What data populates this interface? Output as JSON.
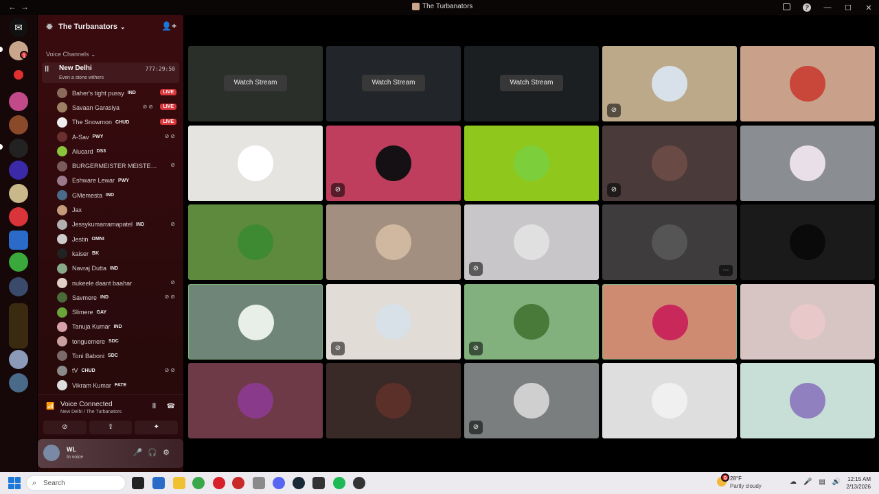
{
  "window": {
    "title": "The Turbanators"
  },
  "server": {
    "name": "The Turbanators"
  },
  "category": "Voice Channels",
  "voice_channel": {
    "name": "New Delhi",
    "timer": "777:29:50",
    "status": "Even a stone withers"
  },
  "members": [
    {
      "name": "Baher's tight pussy",
      "tag": "IND",
      "live": "LIVE",
      "color": "#8a6a5a"
    },
    {
      "name": "Savaan Garasiya",
      "tag": "",
      "live": "LIVE",
      "icons": "⊘⊘",
      "color": "#9c8064"
    },
    {
      "name": "The Snowmon",
      "tag": "CHUD",
      "live": "LIVE",
      "color": "#eeeeee"
    },
    {
      "name": "A-Sav",
      "tag": "PWY",
      "icons": "⊘⊘",
      "color": "#6a3030"
    },
    {
      "name": "Alucard",
      "tag": "DS3",
      "color": "#8ac43a"
    },
    {
      "name": "BURGERMEISTER MEISTERBU...",
      "tag": "",
      "icons": "⊘",
      "color": "#7a5a5a"
    },
    {
      "name": "Eshware Lewar",
      "tag": "PWY",
      "color": "#9a7a8a"
    },
    {
      "name": "GMemesta",
      "tag": "IND",
      "color": "#4a6a8a"
    },
    {
      "name": "Jax",
      "tag": "",
      "color": "#c49a7a"
    },
    {
      "name": "Jessykumarramapatel",
      "tag": "IND",
      "icons": "⊘",
      "color": "#b0b0b0"
    },
    {
      "name": "Jestin",
      "tag": "OMNI",
      "color": "#cccccc"
    },
    {
      "name": "kaiser",
      "tag": "BK",
      "color": "#222222"
    },
    {
      "name": "Navraj Dutta",
      "tag": "IND",
      "color": "#88aa88"
    },
    {
      "name": "nukeele daant baahar",
      "tag": "",
      "icons": "⊘",
      "color": "#e0d0c8"
    },
    {
      "name": "Savmere",
      "tag": "IND",
      "icons": "⊘⊘",
      "color": "#4a6a3a"
    },
    {
      "name": "Slimere",
      "tag": "GAY",
      "color": "#6aa63a"
    },
    {
      "name": "Tanuja Kumar",
      "tag": "IND",
      "color": "#d8a0a8"
    },
    {
      "name": "tonguemere",
      "tag": "SDC",
      "color": "#c9a0a0"
    },
    {
      "name": "Toni Baboni",
      "tag": "SDC",
      "color": "#7a6a6a"
    },
    {
      "name": "tV",
      "tag": "CHUD",
      "icons": "⊘⊘",
      "color": "#8a8a8a"
    },
    {
      "name": "Vikram Kumar",
      "tag": "FATE",
      "color": "#dddddd"
    }
  ],
  "voice_panel": {
    "title": "Voice Connected",
    "subtitle": "New Delhi / The Turbanators"
  },
  "user": {
    "name": "WL",
    "status": "In voice"
  },
  "stream_label": "Watch Stream",
  "tiles": [
    {
      "bg": "#2a2f2a",
      "stream": true
    },
    {
      "bg": "#22262a",
      "stream": true
    },
    {
      "bg": "#1c1f21",
      "stream": true
    },
    {
      "bg": "#bba98a",
      "pic": "#d8e0ea",
      "mute": true
    },
    {
      "bg": "#c9a089",
      "pic": "#c8463a"
    },
    {
      "bg": "#e5e4e0",
      "pic": "#ffffff"
    },
    {
      "bg": "#bf3e5e",
      "pic": "#151013",
      "mute": true
    },
    {
      "bg": "#8fc71c",
      "pic": "#7ccf3a"
    },
    {
      "bg": "#4b3a3a",
      "pic": "#6a4a44",
      "mute": true
    },
    {
      "bg": "#8a8d92",
      "pic": "#e8dfe8"
    },
    {
      "bg": "#5e8a3e",
      "pic": "#3d8a33"
    },
    {
      "bg": "#a38f80",
      "pic": "#d0b8a0"
    },
    {
      "bg": "#c8c6c8",
      "pic": "#e0e0e0",
      "mute": true
    },
    {
      "bg": "#3e3c3c",
      "pic": "#555555",
      "more": "···"
    },
    {
      "bg": "#1a1a1a",
      "pic": "#0a0a0a"
    },
    {
      "bg": "#6f8577",
      "pic": "#e8eee8",
      "sel": true
    },
    {
      "bg": "#e2dcd6",
      "pic": "#d8e0e8",
      "mute": true
    },
    {
      "bg": "#82b17e",
      "pic": "#4a7a3a",
      "mute": true
    },
    {
      "bg": "#cf8a72",
      "pic": "#c8285a",
      "sel": true
    },
    {
      "bg": "#d6c5c2",
      "pic": "#e8c8c8"
    },
    {
      "bg": "#6e3a47",
      "pic": "#8a3a8a"
    },
    {
      "bg": "#3a2a27",
      "pic": "#5a3028"
    },
    {
      "bg": "#7b7e7f",
      "pic": "#cfcfcf",
      "mute": true
    },
    {
      "bg": "#dedede",
      "pic": "#f0f0f0"
    },
    {
      "bg": "#c8dfd8",
      "pic": "#9080c0"
    }
  ],
  "taskbar": {
    "search_placeholder": "Search",
    "weather_temp": "28°F",
    "weather_desc": "Partly cloudy",
    "weather_badge": "9",
    "time": "12:15 AM",
    "date": "2/13/2026"
  },
  "guild_badge": "1"
}
